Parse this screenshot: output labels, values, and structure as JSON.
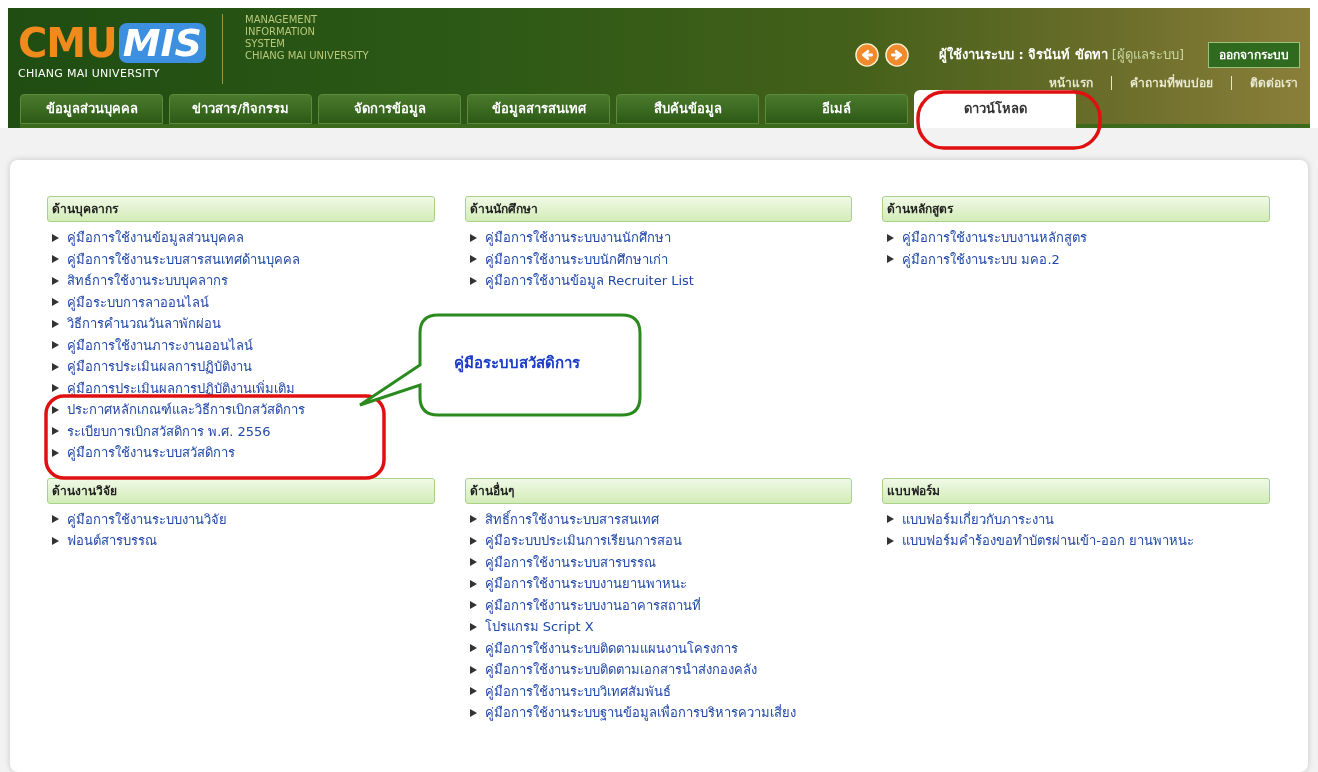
{
  "header": {
    "logo": {
      "part1": "CMU",
      "part2": "MIS",
      "subtitle": "CHIANG MAI UNIVERSITY"
    },
    "tagline": [
      "MANAGEMENT",
      "INFORMATION",
      "SYSTEM",
      "CHIANG MAI UNIVERSITY"
    ],
    "user": {
      "label": "ผู้ใช้งานระบบ : จิรนันท์ ขัดทา",
      "role": "[ผู้ดูแลระบบ]"
    },
    "logout": "ออกจากระบบ",
    "links": [
      "หน้าแรก",
      "คำถามที่พบบ่อย",
      "ติดต่อเรา"
    ],
    "tabs": [
      {
        "label": "ข้อมูลส่วนบุคคล",
        "selected": false
      },
      {
        "label": "ข่าวสาร/กิจกรรม",
        "selected": false
      },
      {
        "label": "จัดการข้อมูล",
        "selected": false
      },
      {
        "label": "ข้อมูลสารสนเทศ",
        "selected": false
      },
      {
        "label": "สืบค้นข้อมูล",
        "selected": false
      },
      {
        "label": "อีเมล์",
        "selected": false
      },
      {
        "label": "ดาวน์โหลด",
        "selected": true
      }
    ]
  },
  "sections": [
    {
      "title": "ด้านบุคลากร",
      "items": [
        "คู่มือการใช้งานข้อมูลส่วนบุคคล",
        "คู่มือการใช้งานระบบสารสนเทศด้านบุคคล",
        "สิทธ์การใช้งานระบบบุคลากร",
        "คู่มือระบบการลาออนไลน์",
        "วิธีการคำนวณวันลาพักผ่อน",
        "คู่มือการใช้งานภาระงานออนไลน์",
        "คู่มือการประเมินผลการปฏิบัติงาน",
        "คู่มือการประเมินผลการปฏิบัติงานเพิ่มเติม",
        "ประกาศหลักเกณฑ์และวิธีการเบิกสวัสดิการ",
        "ระเบียบการเบิกสวัสดิการ พ.ศ. 2556",
        "คู่มือการใช้งานระบบสวัสดิการ"
      ]
    },
    {
      "title": "ด้านนักศึกษา",
      "items": [
        "คู่มือการใช้งานระบบงานนักศึกษา",
        "คู่มือการใช้งานระบบนักศึกษาเก่า",
        "คู่มือการใช้งานข้อมูล Recruiter List"
      ]
    },
    {
      "title": "ด้านหลักสูตร",
      "items": [
        "คู่มือการใช้งานระบบงานหลักสูตร",
        "คู่มือการใช้งานระบบ มคอ.2"
      ]
    },
    {
      "title": "ด้านงานวิจัย",
      "items": [
        "คู่มือการใช้งานระบบงานวิจัย",
        "ฟอนต์สารบรรณ"
      ]
    },
    {
      "title": "ด้านอื่นๆ",
      "items": [
        "สิทธิ์การใช้งานระบบสารสนเทศ",
        "คู่มือระบบประเมินการเรียนการสอน",
        "คู่มือการใช้งานระบบสารบรรณ",
        "คู่มือการใช้งานระบบงานยานพาหนะ",
        "คู่มือการใช้งานระบบงานอาคารสถานที่",
        "โปรแกรม Script X",
        "คู่มือการใช้งานระบบติดตามแผนงานโครงการ",
        "คู่มือการใช้งานระบบติดตามเอกสารนำส่งกองคลัง",
        "คู่มือการใช้งานระบบวิเทศสัมพันธ์",
        "คู่มือการใช้งานระบบฐานข้อมูลเพื่อการบริหารความเสี่ยง"
      ]
    },
    {
      "title": "แบบฟอร์ม",
      "items": [
        "แบบฟอร์มเกี่ยวกับภาระงาน",
        "แบบฟอร์มคำร้องขอทำบัตรผ่านเข้า-ออก ยานพาหนะ"
      ]
    }
  ],
  "annotation": {
    "callout": "คู่มือระบบสวัสดิการ"
  }
}
